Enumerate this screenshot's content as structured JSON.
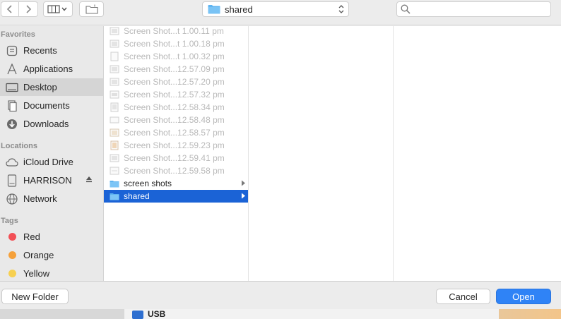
{
  "toolbar": {
    "path_label": "shared",
    "search_placeholder": ""
  },
  "sidebar": {
    "favorites_header": "Favorites",
    "favorites": [
      {
        "label": "Recents",
        "icon": "recents-icon"
      },
      {
        "label": "Applications",
        "icon": "applications-icon"
      },
      {
        "label": "Desktop",
        "icon": "desktop-icon",
        "selected": true
      },
      {
        "label": "Documents",
        "icon": "documents-icon"
      },
      {
        "label": "Downloads",
        "icon": "downloads-icon"
      }
    ],
    "locations_header": "Locations",
    "locations": [
      {
        "label": "iCloud Drive",
        "icon": "cloud-icon"
      },
      {
        "label": "HARRISON",
        "icon": "disk-icon"
      },
      {
        "label": "Network",
        "icon": "network-icon"
      }
    ],
    "tags_header": "Tags",
    "tags": [
      {
        "label": "Red",
        "color": "#f25056"
      },
      {
        "label": "Orange",
        "color": "#f5a13b"
      },
      {
        "label": "Yellow",
        "color": "#f7d050"
      }
    ]
  },
  "files": [
    {
      "name": "Screen Shot...t 1.00.11 pm",
      "type": "image"
    },
    {
      "name": "Screen Shot...t 1.00.18 pm",
      "type": "image"
    },
    {
      "name": "Screen Shot...t 1.00.32 pm",
      "type": "image"
    },
    {
      "name": "Screen Shot...12.57.09 pm",
      "type": "image"
    },
    {
      "name": "Screen Shot...12.57.20 pm",
      "type": "image"
    },
    {
      "name": "Screen Shot...12.57.32 pm",
      "type": "image"
    },
    {
      "name": "Screen Shot...12.58.34 pm",
      "type": "image"
    },
    {
      "name": "Screen Shot...12.58.48 pm",
      "type": "image"
    },
    {
      "name": "Screen Shot...12.58.57 pm",
      "type": "image"
    },
    {
      "name": "Screen Shot...12.59.23 pm",
      "type": "image"
    },
    {
      "name": "Screen Shot...12.59.41 pm",
      "type": "image"
    },
    {
      "name": "Screen Shot...12.59.58 pm",
      "type": "image"
    },
    {
      "name": "screen shots",
      "type": "folder"
    },
    {
      "name": "shared",
      "type": "folder",
      "selected": true
    }
  ],
  "footer": {
    "new_folder_label": "New Folder",
    "cancel_label": "Cancel",
    "open_label": "Open"
  },
  "backdrop": {
    "usb_label": "USB"
  },
  "colors": {
    "accent": "#2f83f6",
    "selection": "#1b63d6",
    "folder": "#5fb4f0"
  }
}
